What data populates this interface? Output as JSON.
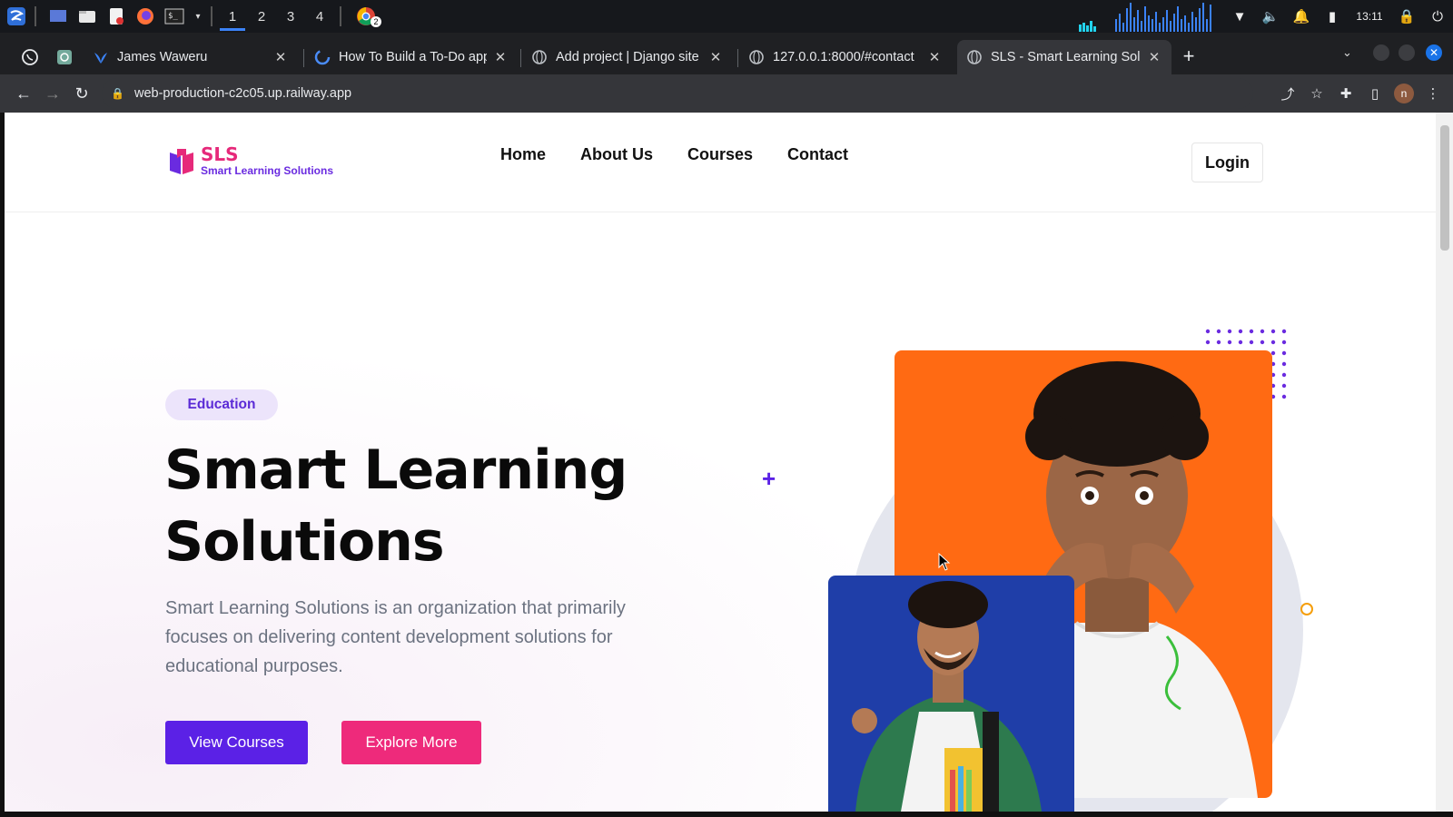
{
  "taskbar": {
    "workspaces": [
      "1",
      "2",
      "3",
      "4"
    ],
    "clock": "13:11",
    "browser_badge": "2"
  },
  "browser": {
    "tabs": [
      {
        "label": "",
        "icon": "whatsapp-icon"
      },
      {
        "label": "",
        "icon": "chatgpt-icon"
      },
      {
        "label": "James Waweru",
        "icon": "bird-icon"
      },
      {
        "label": "How To Build a To-Do app",
        "icon": "loading-icon"
      },
      {
        "label": "Add project | Django site a",
        "icon": "globe-icon"
      },
      {
        "label": "127.0.0.1:8000/#contact",
        "icon": "globe-icon"
      },
      {
        "label": "SLS - Smart Learning Solu",
        "icon": "globe-icon"
      }
    ],
    "url": "web-production-c2c05.up.railway.app",
    "profile_initial": "n"
  },
  "site": {
    "logo": {
      "title": "SLS",
      "subtitle": "Smart Learning Solutions"
    },
    "nav": [
      "Home",
      "About Us",
      "Courses",
      "Contact"
    ],
    "login_label": "Login"
  },
  "hero": {
    "badge": "Education",
    "title_line1": "Smart Learning",
    "title_line2": "Solutions",
    "description": "Smart Learning Solutions is an organization that primarily focuses on delivering content development solutions for educational purposes.",
    "primary_button": "View Courses",
    "secondary_button": "Explore More"
  },
  "colors": {
    "primary": "#5b21e6",
    "accent": "#ee2a7b",
    "orange": "#ff6a13",
    "blue": "#1f3ea8"
  }
}
